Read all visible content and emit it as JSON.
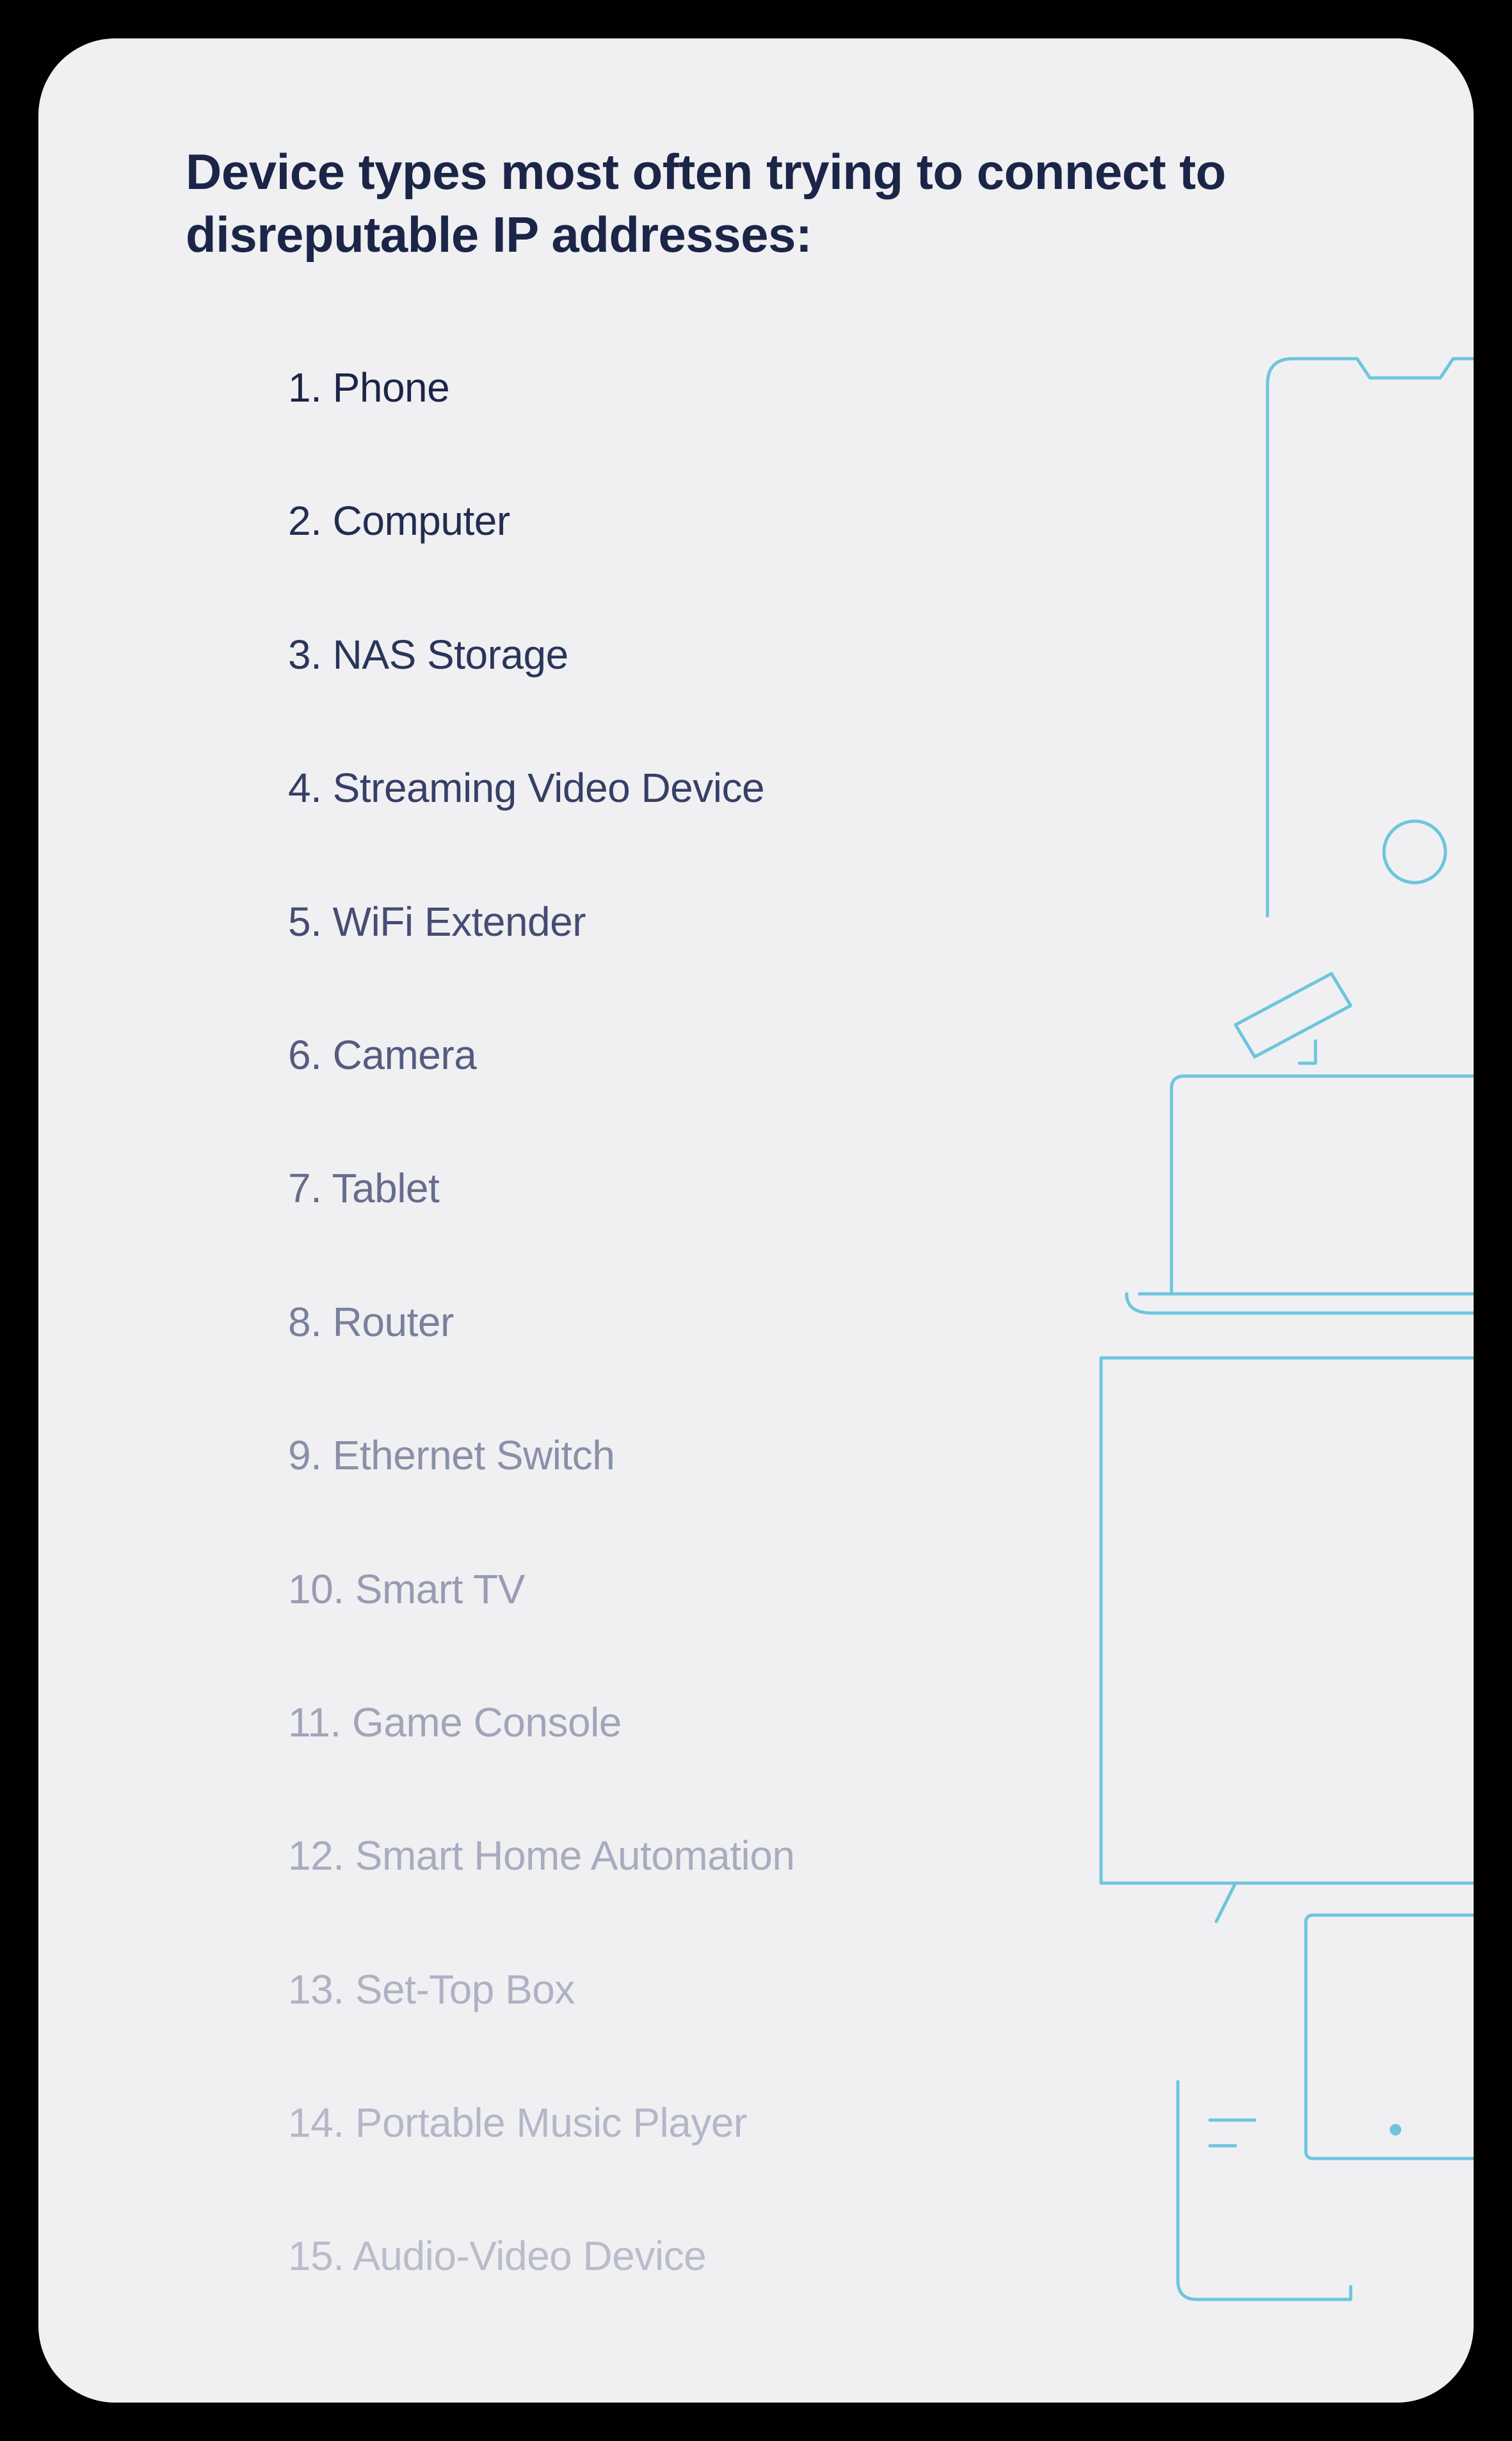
{
  "title": "Device types most often trying to connect to disreputable IP addresses:",
  "items": [
    "1. Phone",
    "2. Computer",
    "3. NAS Storage",
    "4. Streaming Video Device",
    "5. WiFi Extender",
    "6. Camera",
    "7. Tablet",
    "8. Router",
    "9. Ethernet Switch",
    "10. Smart TV",
    "11. Game Console",
    "12. Smart Home Automation",
    "13. Set-Top Box",
    "14. Portable Music Player",
    "15. Audio-Video Device"
  ],
  "colors": {
    "background": "#f0f0f3",
    "heading": "#1b2547",
    "illustration": "#6ec5dd"
  }
}
